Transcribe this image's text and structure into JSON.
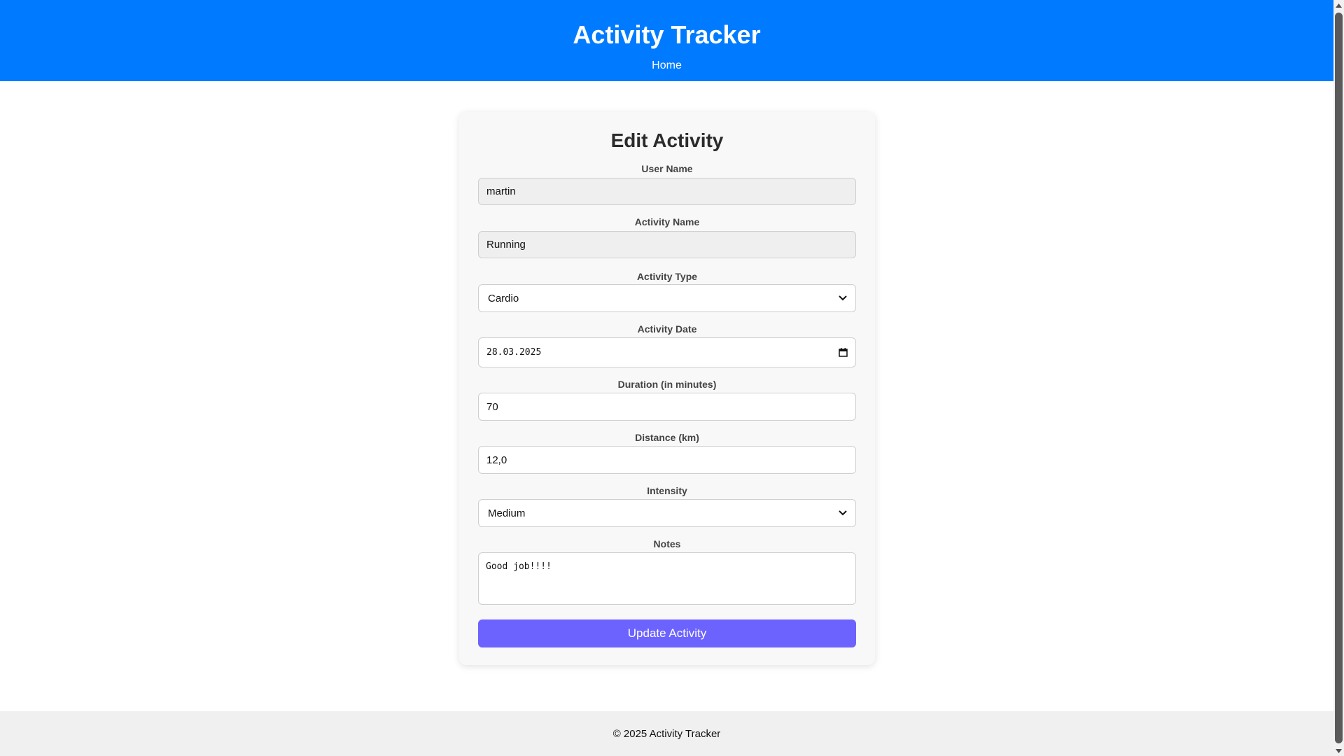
{
  "header": {
    "title": "Activity Tracker",
    "nav_home": "Home"
  },
  "form": {
    "title": "Edit Activity",
    "fields": {
      "user_name": {
        "label": "User Name",
        "value": "martin"
      },
      "activity_name": {
        "label": "Activity Name",
        "value": "Running"
      },
      "activity_type": {
        "label": "Activity Type",
        "value": "Cardio"
      },
      "activity_date": {
        "label": "Activity Date",
        "value": "28.03.2025"
      },
      "duration": {
        "label": "Duration (in minutes)",
        "value": "70"
      },
      "distance": {
        "label": "Distance (km)",
        "value": "12,0"
      },
      "intensity": {
        "label": "Intensity",
        "value": "Medium"
      },
      "notes": {
        "label": "Notes",
        "value": "Good job!!!!"
      }
    },
    "submit_label": "Update Activity"
  },
  "footer": {
    "text": "© 2025 Activity Tracker"
  },
  "colors": {
    "header_bg": "#007bff",
    "button_bg": "#6c63ff",
    "footer_bg": "#f0f0f0"
  },
  "icons": {
    "select": "chevron-down-icon",
    "date": "calendar-icon"
  }
}
